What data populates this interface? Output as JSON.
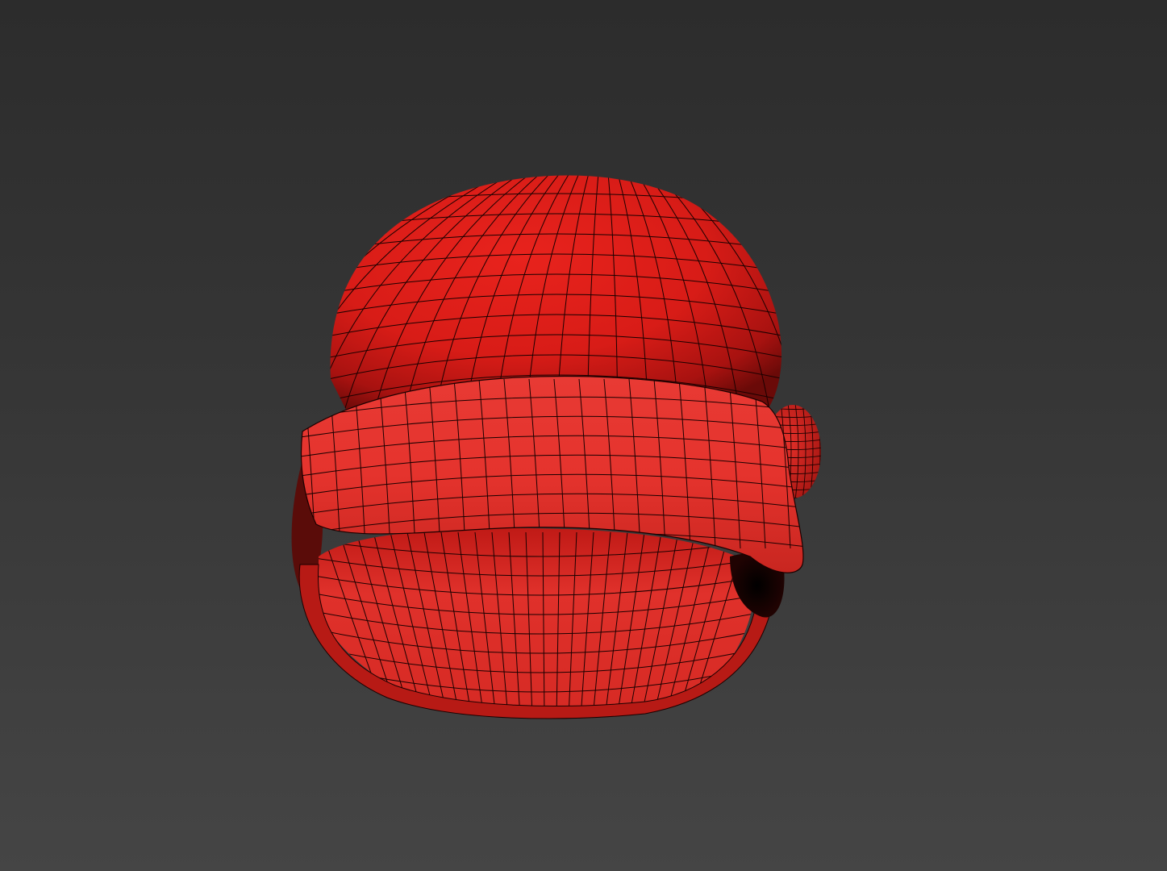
{
  "viewport": {
    "background_top": "#2c2c2c",
    "background_bottom": "#454545"
  },
  "model": {
    "object": "beanie-hat",
    "material_color": "#e0201c",
    "wireframe_color": "#1a0000",
    "shading": "smooth-with-wireframe-overlay"
  }
}
